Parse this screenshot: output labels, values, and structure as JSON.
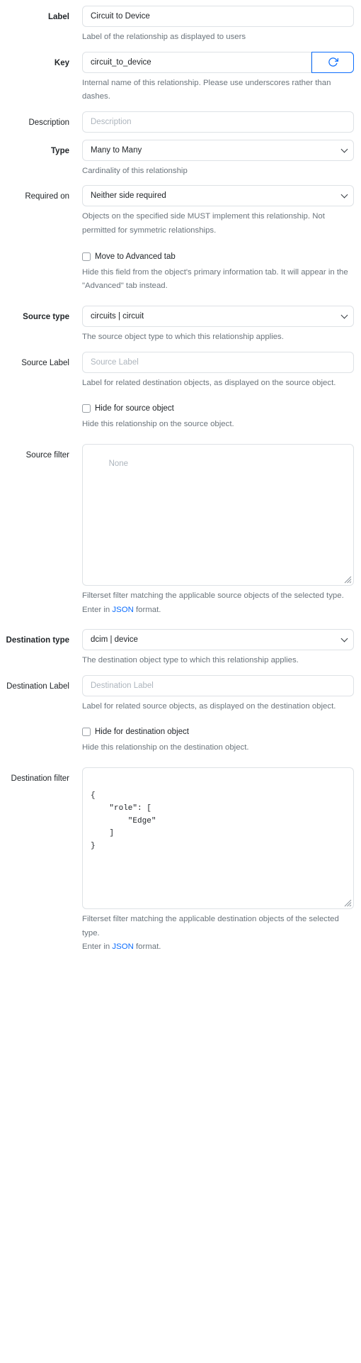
{
  "form": {
    "fields": [
      {
        "id": "label",
        "label": "Label",
        "required": true,
        "control": "input",
        "value": "Circuit to Device",
        "placeholder": "Label",
        "help": "Label of the relationship as displayed to users"
      },
      {
        "id": "key",
        "label": "Key",
        "required": true,
        "control": "input-group",
        "value": "circuit_to_device",
        "placeholder": "Key",
        "button_icon": "refresh-icon",
        "help": "Internal name of this relationship. Please use underscores rather than dashes."
      },
      {
        "id": "description",
        "label": "Description",
        "required": false,
        "control": "input",
        "value": "",
        "placeholder": "Description",
        "help": ""
      },
      {
        "id": "type",
        "label": "Type",
        "required": true,
        "control": "select",
        "value": "Many to Many",
        "help": "Cardinality of this relationship"
      },
      {
        "id": "required_on",
        "label": "Required on",
        "required": false,
        "control": "select",
        "value": "Neither side required",
        "help": "Objects on the specified side MUST implement this relationship. Not permitted for symmetric relationships."
      },
      {
        "id": "advanced_ui",
        "label": "",
        "required": false,
        "control": "checkbox",
        "checkbox_label": "Move to Advanced tab",
        "checked": false,
        "help": "Hide this field from the object's primary information tab. It will appear in the \"Advanced\" tab instead."
      },
      {
        "id": "source_type",
        "label": "Source type",
        "required": true,
        "control": "select",
        "value": "circuits | circuit",
        "help": "The source object type to which this relationship applies."
      },
      {
        "id": "source_label",
        "label": "Source Label",
        "required": false,
        "control": "input",
        "value": "",
        "placeholder": "Source Label",
        "help": "Label for related destination objects, as displayed on the source object."
      },
      {
        "id": "source_hidden",
        "label": "",
        "required": false,
        "control": "checkbox",
        "checkbox_label": "Hide for source object",
        "checked": false,
        "help": "Hide this relationship on the source object."
      },
      {
        "id": "source_filter",
        "label": "Source filter",
        "required": false,
        "control": "textarea",
        "value": "",
        "placeholder": "None",
        "help": "Filterset filter matching the applicable source objects of the selected type.",
        "help2_before": "Enter in ",
        "help2_link": "JSON",
        "help2_after": " format."
      },
      {
        "id": "destination_type",
        "label": "Destination type",
        "required": true,
        "control": "select",
        "value": "dcim | device",
        "help": "The destination object type to which this relationship applies."
      },
      {
        "id": "destination_label",
        "label": "Destination Label",
        "required": false,
        "control": "input",
        "value": "",
        "placeholder": "Destination Label",
        "help": "Label for related source objects, as displayed on the destination object."
      },
      {
        "id": "destination_hidden",
        "label": "",
        "required": false,
        "control": "checkbox",
        "checkbox_label": "Hide for destination object",
        "checked": false,
        "help": "Hide this relationship on the destination object."
      },
      {
        "id": "destination_filter",
        "label": "Destination filter",
        "required": false,
        "control": "textarea",
        "value": "{\n    \"role\": [\n        \"Edge\"\n    ]\n}",
        "placeholder": "None",
        "help": "Filterset filter matching the applicable destination objects of the selected type.",
        "help2_before": "Enter in ",
        "help2_link": "JSON",
        "help2_after": " format."
      }
    ]
  },
  "colors": {
    "accent": "#0d6efd",
    "text": "#212529",
    "muted": "#6c757d",
    "border": "#dee2e6",
    "placeholder": "#adb5bd"
  }
}
